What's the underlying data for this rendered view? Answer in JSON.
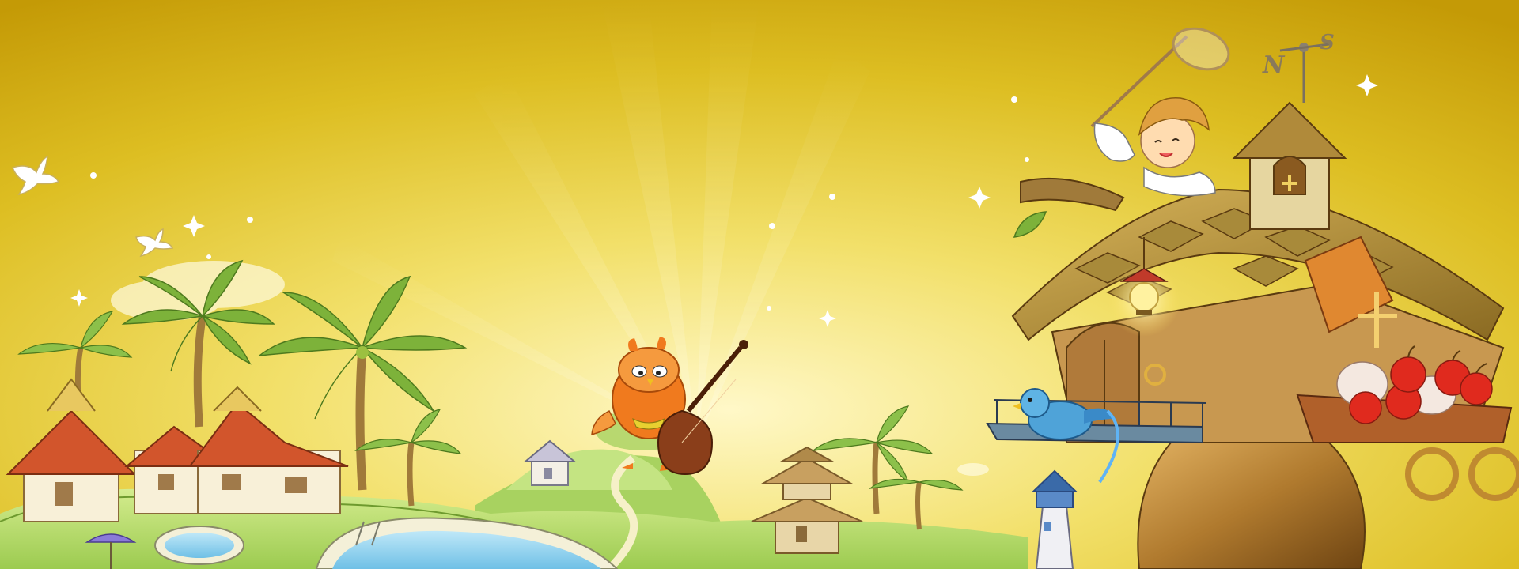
{
  "scene": {
    "compass": {
      "north_label": "N",
      "south_label": "S"
    }
  },
  "palette": {
    "sky_top": "#C49A06",
    "sky_mid": "#E8D02A",
    "sky_glow": "#FFF8C8",
    "grass": "#B9DC6A",
    "grass_dark": "#86B83E",
    "pool_water": "#9FD8F0",
    "roof_red": "#D2552C",
    "wood": "#B07A2E",
    "wood_dark": "#7A4E1A",
    "bird_orange": "#F07A1E",
    "bird_blue": "#4FA3D8",
    "apple_red": "#E02A1E",
    "palm_leaf": "#7DB23A"
  },
  "elements": [
    "dove-icon",
    "palm-tree-icon",
    "thai-house-icon",
    "swimming-pool-icon",
    "owl-cello-player-icon",
    "pagoda-icon",
    "lighthouse-icon",
    "treehouse-icon",
    "boy-with-net-icon",
    "weather-vane-icon",
    "lantern-icon",
    "blue-bird-icon",
    "fruit-cart-icon"
  ]
}
